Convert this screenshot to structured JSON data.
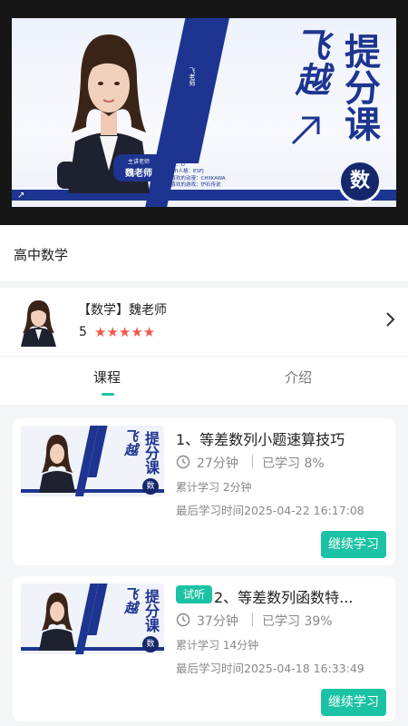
{
  "banner": {
    "title_left": "飞越",
    "title_right": "提分课",
    "subject": "数",
    "vertical_1": "飞老师",
    "vertical_2": "●赵子年",
    "name_tag_top": "主讲老师",
    "name_tag": "魏老师",
    "info": [
      "星座：天秤座",
      "血型：O",
      "MBTI人格：ESFJ",
      "最喜欢的动漫：CHIIKAWA",
      "最喜欢的游戏：炉石传说"
    ]
  },
  "subject_label": "高中数学",
  "teacher": {
    "name": "【数学】魏老师",
    "score": "5",
    "stars": "★★★★★"
  },
  "tabs": [
    {
      "label": "课程",
      "active": true
    },
    {
      "label": "介绍",
      "active": false
    }
  ],
  "courses": [
    {
      "title": "1、等差数列小题速算技巧",
      "trial": "",
      "duration": "27分钟",
      "progress": "已学习 8%",
      "cumulative": "累计学习 2分钟",
      "last_time": "最后学习时间2025-04-22 16:17:08",
      "button": "继续学习"
    },
    {
      "title": "2、等差数列函数特...",
      "trial": "试听",
      "duration": "37分钟",
      "progress": "已学习 39%",
      "cumulative": "累计学习 14分钟",
      "last_time": "最后学习时间2025-04-18 16:33:49",
      "button": "继续学习"
    }
  ],
  "thumb_text": {
    "left": "飞越",
    "right": "提分课",
    "subject": "数"
  },
  "colors": {
    "accent": "#1bc3a4",
    "brand_blue": "#1d3590",
    "star": "#f05a4a"
  }
}
